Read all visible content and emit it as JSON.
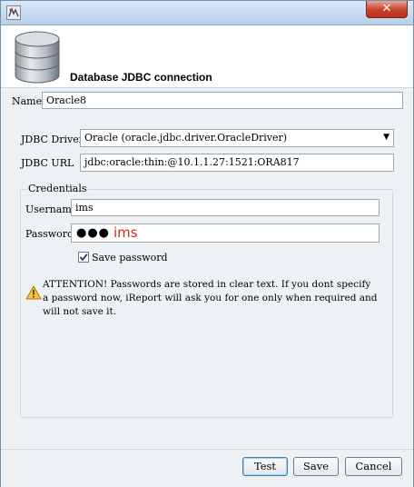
{
  "window": {
    "header_title": "Database JDBC connection"
  },
  "form": {
    "name_label": "Name",
    "name_value": "Oracle8",
    "driver_label": "JDBC Driver",
    "driver_value": "Oracle (oracle.jdbc.driver.OracleDriver)",
    "url_label": "JDBC URL",
    "url_value": "jdbc:oracle:thin:@10.1.1.27:1521:ORA817"
  },
  "credentials": {
    "legend": "Credentials",
    "username_label": "Username",
    "username_value": "ims",
    "password_label": "Password",
    "password_masked": "●●●",
    "password_annotation": "ims",
    "save_password_label": "Save password",
    "save_password_checked": true,
    "attention_text": "ATTENTION! Passwords are stored in clear text. If you dont specify a password now, iReport will ask you for one only when required and will not save it."
  },
  "buttons": {
    "test": "Test",
    "save": "Save",
    "cancel": "Cancel"
  },
  "icons": {
    "title": "app-icon",
    "close": "close-icon",
    "header": "database-icon",
    "dropdown": "chevron-down-icon",
    "warning": "warning-icon"
  },
  "colors": {
    "password_annotation": "#d9261c",
    "close_button": "#c7402b"
  }
}
